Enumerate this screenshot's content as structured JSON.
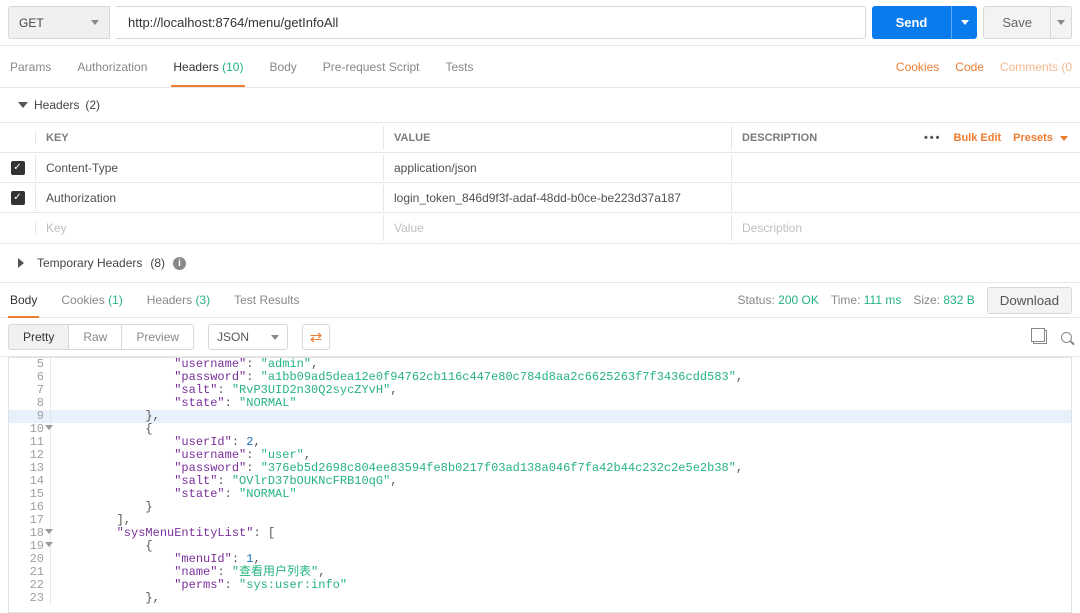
{
  "request": {
    "method": "GET",
    "url": "http://localhost:8764/menu/getInfoAll",
    "send_label": "Send",
    "save_label": "Save"
  },
  "req_tabs": {
    "params": "Params",
    "authorization": "Authorization",
    "headers": "Headers",
    "headers_count": "(10)",
    "body": "Body",
    "prerequest": "Pre-request Script",
    "tests": "Tests"
  },
  "right_links": {
    "cookies": "Cookies",
    "code": "Code",
    "comments": "Comments (0"
  },
  "headers_section": {
    "title": "Headers",
    "count": "(2)",
    "col_key": "KEY",
    "col_value": "VALUE",
    "col_desc": "DESCRIPTION",
    "bulk": "Bulk Edit",
    "presets": "Presets",
    "rows": [
      {
        "enabled": true,
        "key": "Content-Type",
        "value": "application/json"
      },
      {
        "enabled": true,
        "key": "Authorization",
        "value": "login_token_846d9f3f-adaf-48dd-b0ce-be223d37a187"
      }
    ],
    "ph_key": "Key",
    "ph_value": "Value",
    "ph_desc": "Description"
  },
  "temp_headers": {
    "label": "Temporary Headers",
    "count": "(8)"
  },
  "resp_tabs": {
    "body": "Body",
    "cookies": "Cookies",
    "cookies_count": "(1)",
    "headers": "Headers",
    "headers_count": "(3)",
    "test_results": "Test Results"
  },
  "status_row": {
    "status_label": "Status:",
    "status_value": "200 OK",
    "time_label": "Time:",
    "time_value": "111 ms",
    "size_label": "Size:",
    "size_value": "832 B",
    "download": "Download"
  },
  "body_toolbar": {
    "pretty": "Pretty",
    "raw": "Raw",
    "preview": "Preview",
    "json": "JSON"
  },
  "code_lines": [
    {
      "n": 5,
      "indent": 16,
      "tokens": [
        [
          "key",
          "\"username\""
        ],
        [
          "punc",
          ": "
        ],
        [
          "str",
          "\"admin\""
        ],
        [
          "punc",
          ","
        ]
      ]
    },
    {
      "n": 6,
      "indent": 16,
      "tokens": [
        [
          "key",
          "\"password\""
        ],
        [
          "punc",
          ": "
        ],
        [
          "str",
          "\"a1bb09ad5dea12e0f94762cb116c447e80c784d8aa2c6625263f7f3436cdd583\""
        ],
        [
          "punc",
          ","
        ]
      ]
    },
    {
      "n": 7,
      "indent": 16,
      "tokens": [
        [
          "key",
          "\"salt\""
        ],
        [
          "punc",
          ": "
        ],
        [
          "str",
          "\"RvP3UID2n30Q2sycZYvH\""
        ],
        [
          "punc",
          ","
        ]
      ]
    },
    {
      "n": 8,
      "indent": 16,
      "tokens": [
        [
          "key",
          "\"state\""
        ],
        [
          "punc",
          ": "
        ],
        [
          "str",
          "\"NORMAL\""
        ]
      ]
    },
    {
      "n": 9,
      "indent": 12,
      "hl": true,
      "tokens": [
        [
          "punc",
          "},"
        ]
      ]
    },
    {
      "n": 10,
      "indent": 12,
      "fold": true,
      "tokens": [
        [
          "punc",
          "{"
        ]
      ]
    },
    {
      "n": 11,
      "indent": 16,
      "tokens": [
        [
          "key",
          "\"userId\""
        ],
        [
          "punc",
          ": "
        ],
        [
          "num",
          "2"
        ],
        [
          "punc",
          ","
        ]
      ]
    },
    {
      "n": 12,
      "indent": 16,
      "tokens": [
        [
          "key",
          "\"username\""
        ],
        [
          "punc",
          ": "
        ],
        [
          "str",
          "\"user\""
        ],
        [
          "punc",
          ","
        ]
      ]
    },
    {
      "n": 13,
      "indent": 16,
      "tokens": [
        [
          "key",
          "\"password\""
        ],
        [
          "punc",
          ": "
        ],
        [
          "str",
          "\"376eb5d2698c804ee83594fe8b0217f03ad138a046f7fa42b44c232c2e5e2b38\""
        ],
        [
          "punc",
          ","
        ]
      ]
    },
    {
      "n": 14,
      "indent": 16,
      "tokens": [
        [
          "key",
          "\"salt\""
        ],
        [
          "punc",
          ": "
        ],
        [
          "str",
          "\"OVlrD37bOUKNcFRB10qG\""
        ],
        [
          "punc",
          ","
        ]
      ]
    },
    {
      "n": 15,
      "indent": 16,
      "tokens": [
        [
          "key",
          "\"state\""
        ],
        [
          "punc",
          ": "
        ],
        [
          "str",
          "\"NORMAL\""
        ]
      ]
    },
    {
      "n": 16,
      "indent": 12,
      "tokens": [
        [
          "punc",
          "}"
        ]
      ]
    },
    {
      "n": 17,
      "indent": 8,
      "tokens": [
        [
          "punc",
          "],"
        ]
      ]
    },
    {
      "n": 18,
      "indent": 8,
      "fold": true,
      "tokens": [
        [
          "key",
          "\"sysMenuEntityList\""
        ],
        [
          "punc",
          ": ["
        ]
      ]
    },
    {
      "n": 19,
      "indent": 12,
      "fold": true,
      "tokens": [
        [
          "punc",
          "{"
        ]
      ]
    },
    {
      "n": 20,
      "indent": 16,
      "tokens": [
        [
          "key",
          "\"menuId\""
        ],
        [
          "punc",
          ": "
        ],
        [
          "num",
          "1"
        ],
        [
          "punc",
          ","
        ]
      ]
    },
    {
      "n": 21,
      "indent": 16,
      "tokens": [
        [
          "key",
          "\"name\""
        ],
        [
          "punc",
          ": "
        ],
        [
          "str",
          "\"查看用户列表\""
        ],
        [
          "punc",
          ","
        ]
      ]
    },
    {
      "n": 22,
      "indent": 16,
      "tokens": [
        [
          "key",
          "\"perms\""
        ],
        [
          "punc",
          ": "
        ],
        [
          "str",
          "\"sys:user:info\""
        ]
      ]
    },
    {
      "n": 23,
      "indent": 12,
      "tokens": [
        [
          "punc",
          "},"
        ]
      ]
    }
  ]
}
